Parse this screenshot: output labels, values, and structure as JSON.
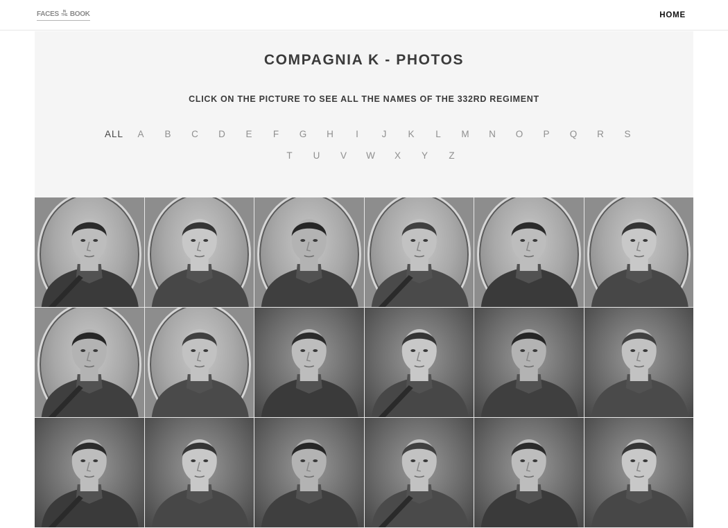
{
  "header": {
    "logo": {
      "word1": "FACES",
      "small": "IN THE",
      "word2": "BOOK"
    },
    "home_label": "HOME"
  },
  "hero": {
    "title": "COMPAGNIA K - PHOTOS",
    "subtitle": "CLICK ON THE PICTURE TO SEE ALL THE NAMES OF THE 332RD REGIMENT"
  },
  "filters": {
    "active": "ALL",
    "letters": [
      "ALL",
      "A",
      "B",
      "C",
      "D",
      "E",
      "F",
      "G",
      "H",
      "I",
      "J",
      "K",
      "L",
      "M",
      "N",
      "O",
      "P",
      "Q",
      "R",
      "S",
      "T",
      "U",
      "V",
      "W",
      "X",
      "Y",
      "Z"
    ]
  },
  "gallery": {
    "photos": [
      {
        "style": "oval",
        "icon": "soldier-portrait-icon"
      },
      {
        "style": "oval",
        "icon": "soldier-portrait-icon"
      },
      {
        "style": "oval",
        "icon": "soldier-portrait-icon"
      },
      {
        "style": "oval",
        "icon": "soldier-portrait-icon"
      },
      {
        "style": "oval",
        "icon": "soldier-portrait-icon"
      },
      {
        "style": "oval",
        "icon": "soldier-portrait-icon"
      },
      {
        "style": "oval",
        "icon": "soldier-portrait-icon"
      },
      {
        "style": "oval",
        "icon": "soldier-portrait-icon"
      },
      {
        "style": "plain",
        "icon": "soldier-portrait-icon"
      },
      {
        "style": "plain",
        "icon": "soldier-portrait-icon"
      },
      {
        "style": "plain",
        "icon": "soldier-portrait-icon"
      },
      {
        "style": "plain",
        "icon": "soldier-portrait-icon"
      },
      {
        "style": "plain",
        "icon": "soldier-portrait-icon"
      },
      {
        "style": "plain",
        "icon": "soldier-portrait-icon"
      },
      {
        "style": "plain",
        "icon": "soldier-portrait-icon"
      },
      {
        "style": "plain",
        "icon": "soldier-portrait-icon"
      },
      {
        "style": "plain",
        "icon": "soldier-portrait-icon"
      },
      {
        "style": "plain",
        "icon": "soldier-portrait-icon"
      }
    ]
  },
  "colors": {
    "hero_background": "#f5f5f5",
    "text_dark": "#3a3a3a",
    "filter_inactive": "#8f8f8f"
  }
}
